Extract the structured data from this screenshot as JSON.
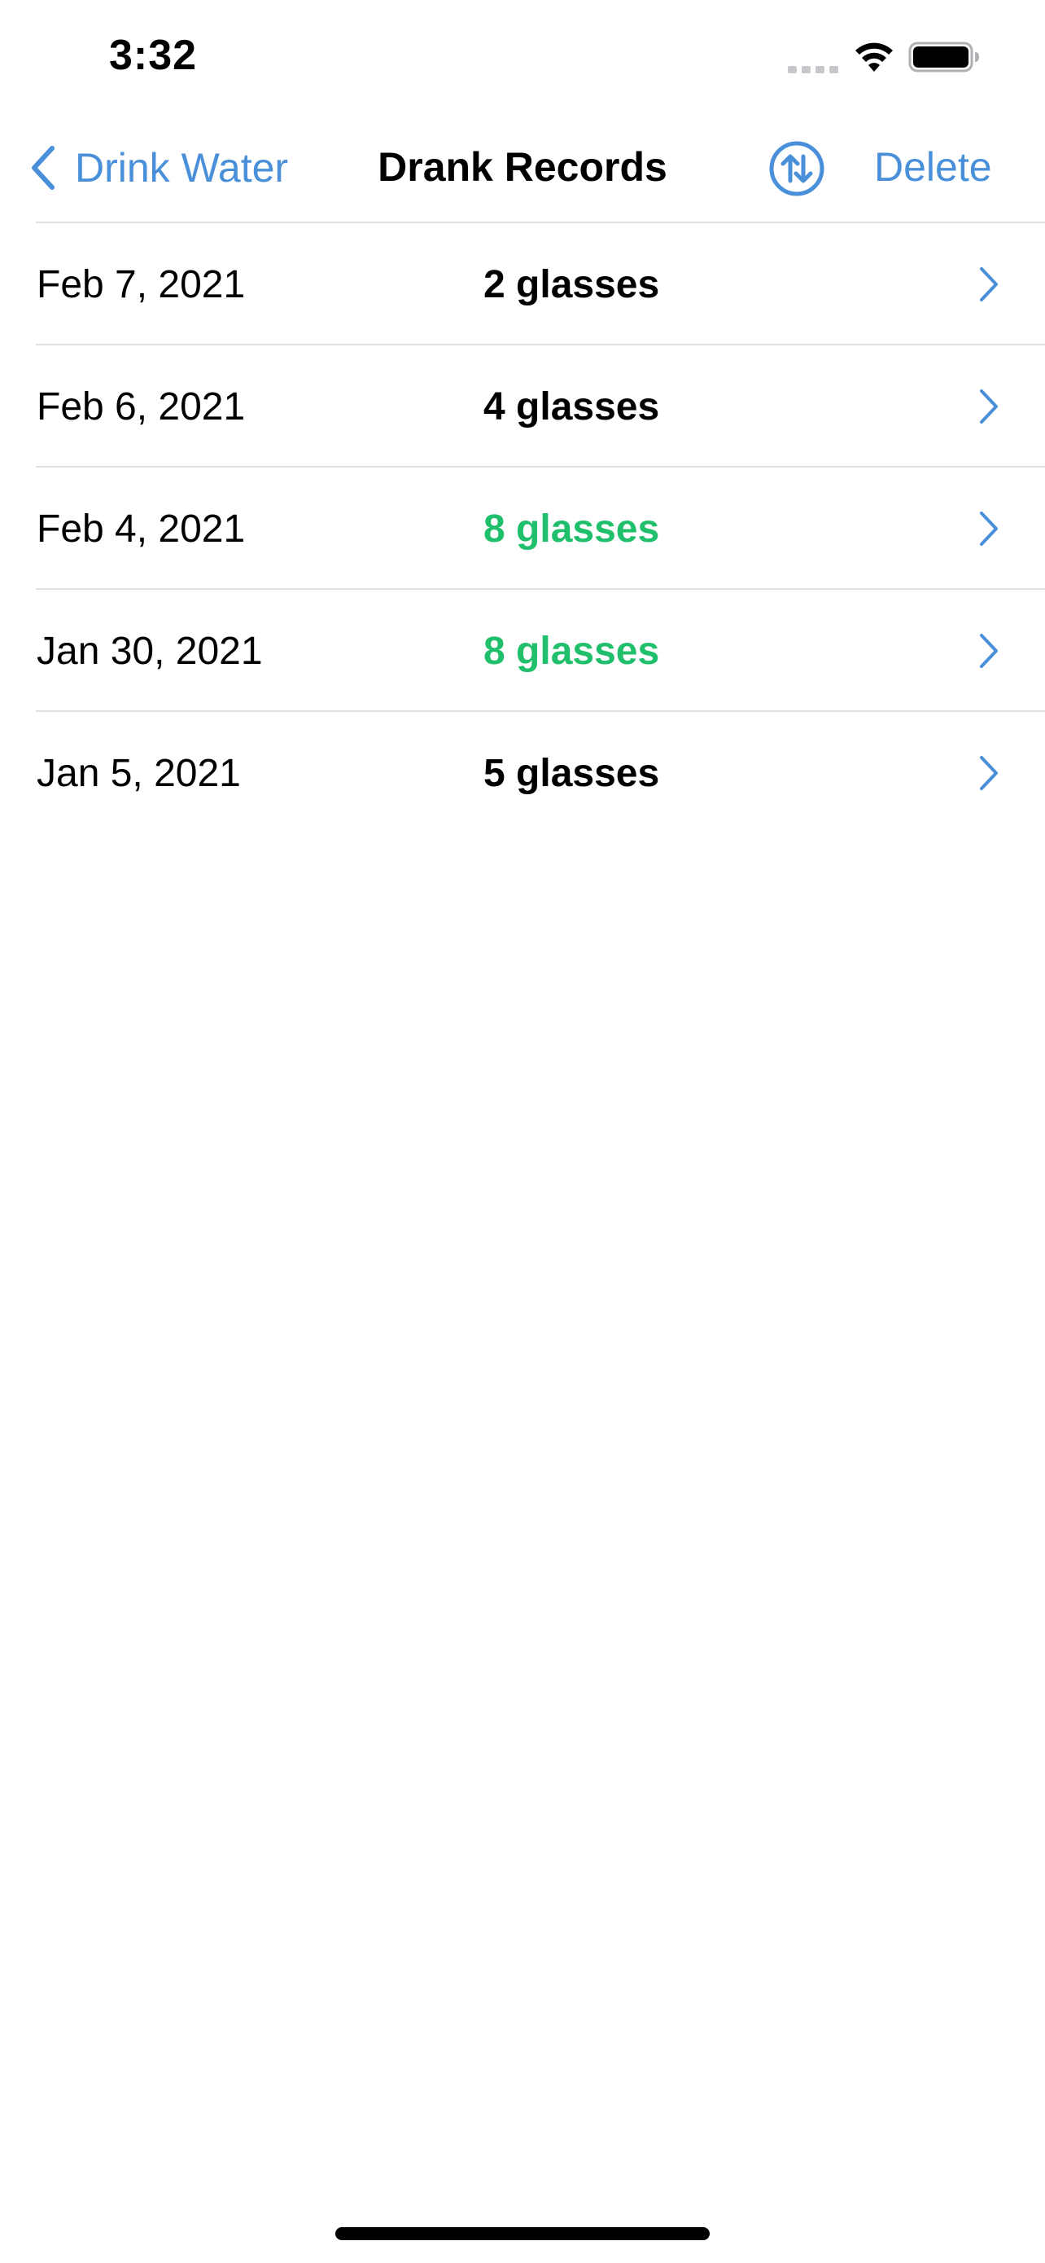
{
  "status_bar": {
    "time": "3:32"
  },
  "nav": {
    "back_label": "Drink Water",
    "title": "Drank Records",
    "delete_label": "Delete",
    "sort_icon": "sort-arrows-circle-icon"
  },
  "colors": {
    "accent": "#4a8fd9",
    "goal_met": "#1fbf6b",
    "text": "#000000",
    "divider": "#e2e2e6"
  },
  "records": [
    {
      "date": "Feb 7, 2021",
      "amount": "2 glasses",
      "goal_met": false
    },
    {
      "date": "Feb 6, 2021",
      "amount": "4 glasses",
      "goal_met": false
    },
    {
      "date": "Feb 4, 2021",
      "amount": "8 glasses",
      "goal_met": true
    },
    {
      "date": "Jan 30, 2021",
      "amount": "8 glasses",
      "goal_met": true
    },
    {
      "date": "Jan 5, 2021",
      "amount": "5 glasses",
      "goal_met": false
    }
  ]
}
